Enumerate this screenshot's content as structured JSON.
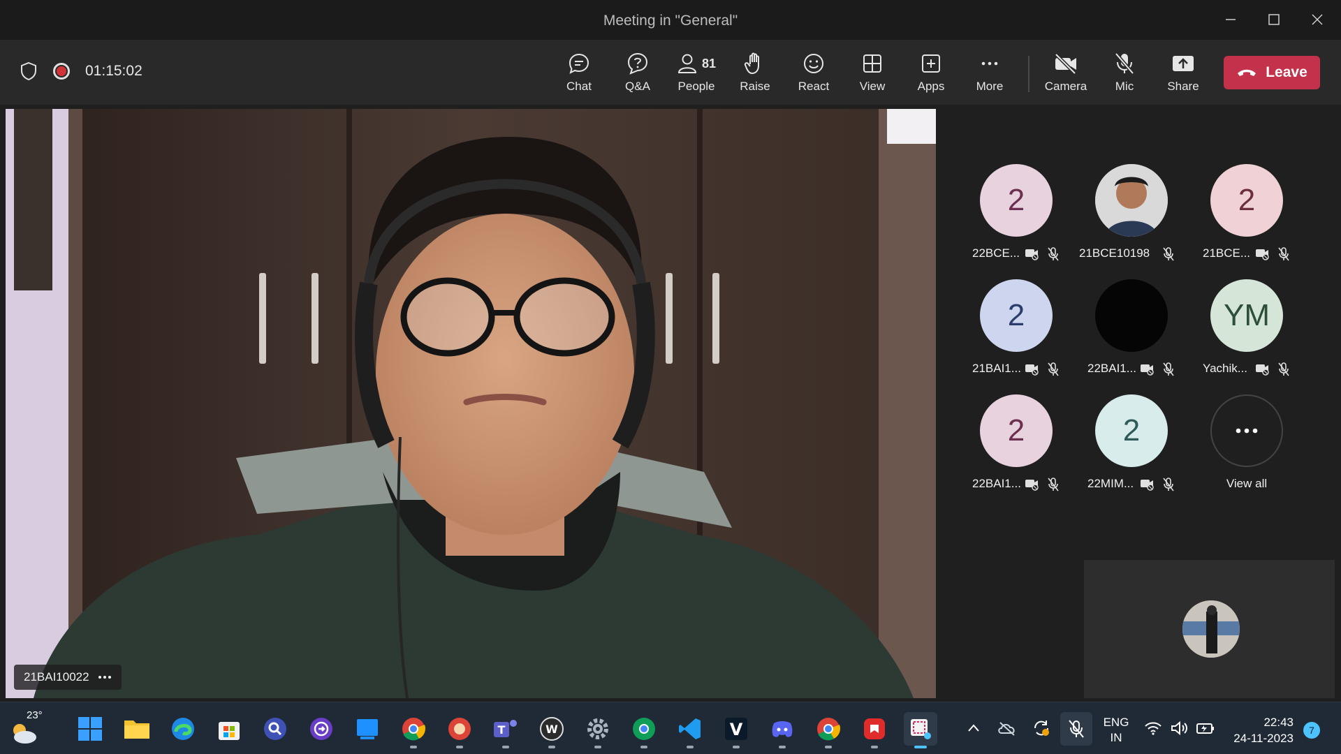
{
  "window": {
    "title": "Meeting in \"General\""
  },
  "toolbar": {
    "timer": "01:15:02",
    "buttons": [
      {
        "key": "chat",
        "label": "Chat"
      },
      {
        "key": "qa",
        "label": "Q&A"
      },
      {
        "key": "people",
        "label": "People",
        "count": "81"
      },
      {
        "key": "raise",
        "label": "Raise"
      },
      {
        "key": "react",
        "label": "React"
      },
      {
        "key": "view",
        "label": "View"
      },
      {
        "key": "apps",
        "label": "Apps"
      },
      {
        "key": "more",
        "label": "More"
      },
      {
        "key": "camera",
        "label": "Camera"
      },
      {
        "key": "mic",
        "label": "Mic"
      },
      {
        "key": "share",
        "label": "Share"
      }
    ],
    "leave_label": "Leave"
  },
  "main_video": {
    "name": "21BAI10022"
  },
  "participants": [
    {
      "name": "22BCE...",
      "initials": "2",
      "bg": "#e8d2de",
      "fg": "#6b2f4f"
    },
    {
      "name": "21BCE10198",
      "initials": "",
      "bg": "#c8c8c8",
      "fg": "#333"
    },
    {
      "name": "21BCE...",
      "initials": "2",
      "bg": "#f0d2d6",
      "fg": "#6b2f3a"
    },
    {
      "name": "21BAI1...",
      "initials": "2",
      "bg": "#cdd6ee",
      "fg": "#2c3c6b"
    },
    {
      "name": "22BAI1...",
      "initials": "",
      "bg": "#050505",
      "fg": "#fff"
    },
    {
      "name": "Yachik...",
      "initials": "YM",
      "bg": "#d5e6d9",
      "fg": "#2d4f38"
    },
    {
      "name": "22BAI1...",
      "initials": "2",
      "bg": "#e8d2de",
      "fg": "#6b2f4f"
    },
    {
      "name": "22MIM...",
      "initials": "2",
      "bg": "#d8ecec",
      "fg": "#2e5a5a"
    }
  ],
  "view_all": {
    "label": "View all"
  },
  "taskbar": {
    "weather_temp": "23°",
    "lang_top": "ENG",
    "lang_bottom": "IN",
    "time": "22:43",
    "date": "24-11-2023",
    "notifications": "7"
  },
  "colors": {
    "leave": "#c4314b",
    "recording": "#d13438",
    "accent": "#4cc2ff"
  }
}
